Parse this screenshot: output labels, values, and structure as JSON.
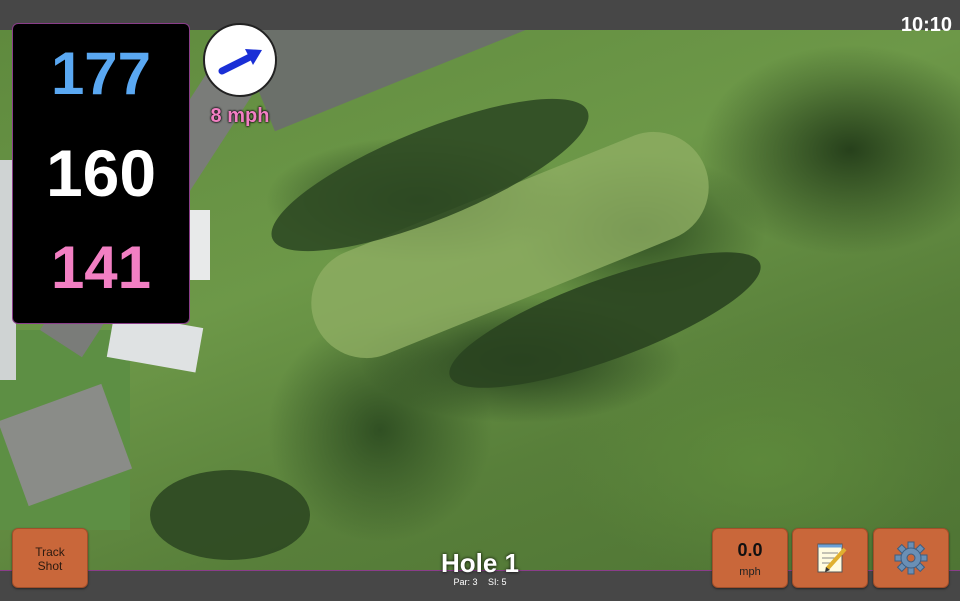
{
  "status": {
    "time": "10:10"
  },
  "distances": {
    "back": "177",
    "middle": "160",
    "front": "141"
  },
  "wind": {
    "speed": "8 mph",
    "arrow_icon": "wind-arrow-icon"
  },
  "buttons": {
    "track_shot": "Track\nShot",
    "speed_value": "0.0",
    "speed_unit": "mph",
    "notes_icon": "notepad-icon",
    "settings_icon": "gear-icon"
  },
  "hole": {
    "title": "Hole 1",
    "par": "Par: 3",
    "si": "SI: 5"
  },
  "colors": {
    "back_distance": "#5aa8f2",
    "middle_distance": "#ffffff",
    "front_distance": "#f27fc3",
    "button_bg": "#c9673a",
    "border_accent": "#8a3d8a"
  }
}
